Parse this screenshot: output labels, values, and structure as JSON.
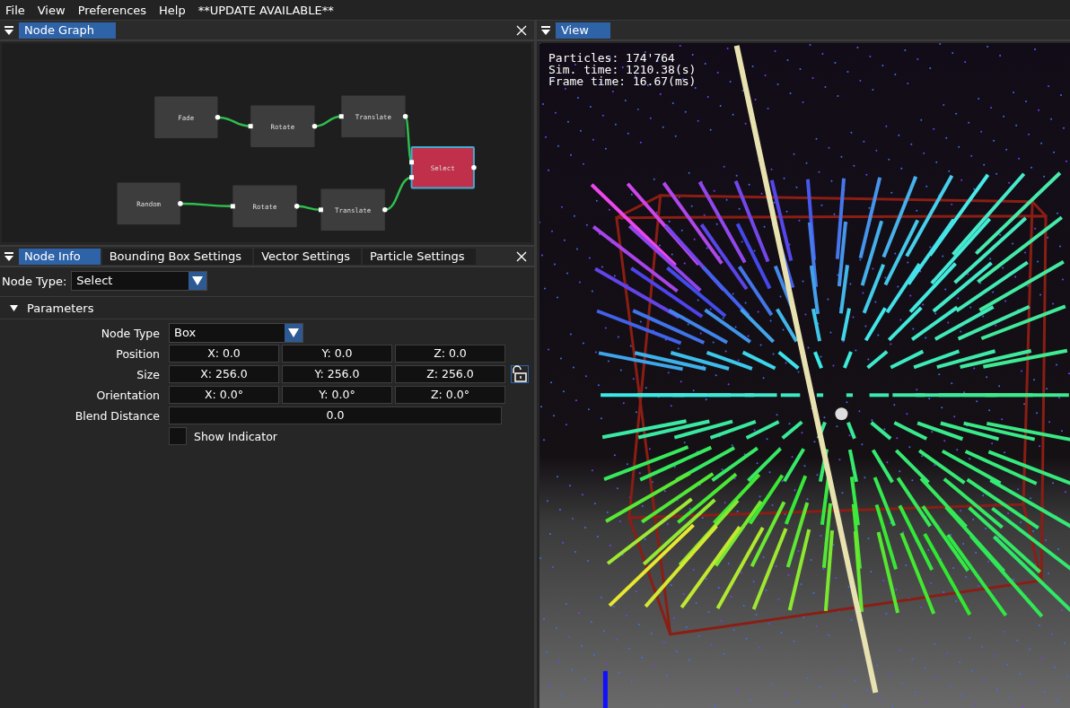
{
  "menu": [
    {
      "label": "File"
    },
    {
      "label": "View"
    },
    {
      "label": "Preferences"
    },
    {
      "label": "Help"
    },
    {
      "label": "**UPDATE AVAILABLE**"
    }
  ],
  "node_graph": {
    "title": "Node Graph",
    "nodes": [
      {
        "label": "Fade",
        "selected": false
      },
      {
        "label": "Rotate",
        "selected": false
      },
      {
        "label": "Translate",
        "selected": false
      },
      {
        "label": "Select",
        "selected": true
      },
      {
        "label": "Random",
        "selected": false
      },
      {
        "label": "Rotate",
        "selected": false
      },
      {
        "label": "Translate",
        "selected": false
      }
    ]
  },
  "node_info": {
    "tabs": [
      {
        "label": "Node Info",
        "selected": true
      },
      {
        "label": "Bounding Box Settings",
        "selected": false
      },
      {
        "label": "Vector Settings",
        "selected": false
      },
      {
        "label": "Particle Settings",
        "selected": false
      }
    ],
    "node_type": {
      "label": "Node Type:",
      "value": "Select"
    },
    "section": {
      "title": "Parameters",
      "expanded": true
    },
    "params": [
      {
        "kind": "dropdown",
        "label": "Node Type",
        "value": "Box"
      },
      {
        "kind": "vector",
        "label": "Position",
        "values": [
          "X: 0.0",
          "Y: 0.0",
          "Z: 0.0"
        ]
      },
      {
        "kind": "vector",
        "label": "Size",
        "values": [
          "X: 256.0",
          "Y: 256.0",
          "Z: 256.0"
        ],
        "locked": false
      },
      {
        "kind": "vector",
        "label": "Orientation",
        "values": [
          "X: 0.0°",
          "Y: 0.0°",
          "Z: 0.0°"
        ]
      },
      {
        "kind": "scalar",
        "label": "Blend Distance",
        "value": "0.0"
      },
      {
        "kind": "checkbox",
        "label": "Show Indicator",
        "checked": false
      }
    ]
  },
  "view": {
    "title": "View",
    "stats": [
      "Particles: 174'764",
      "Sim. time: 1210.38(s)",
      "Frame time: 16.67(ms)"
    ]
  }
}
